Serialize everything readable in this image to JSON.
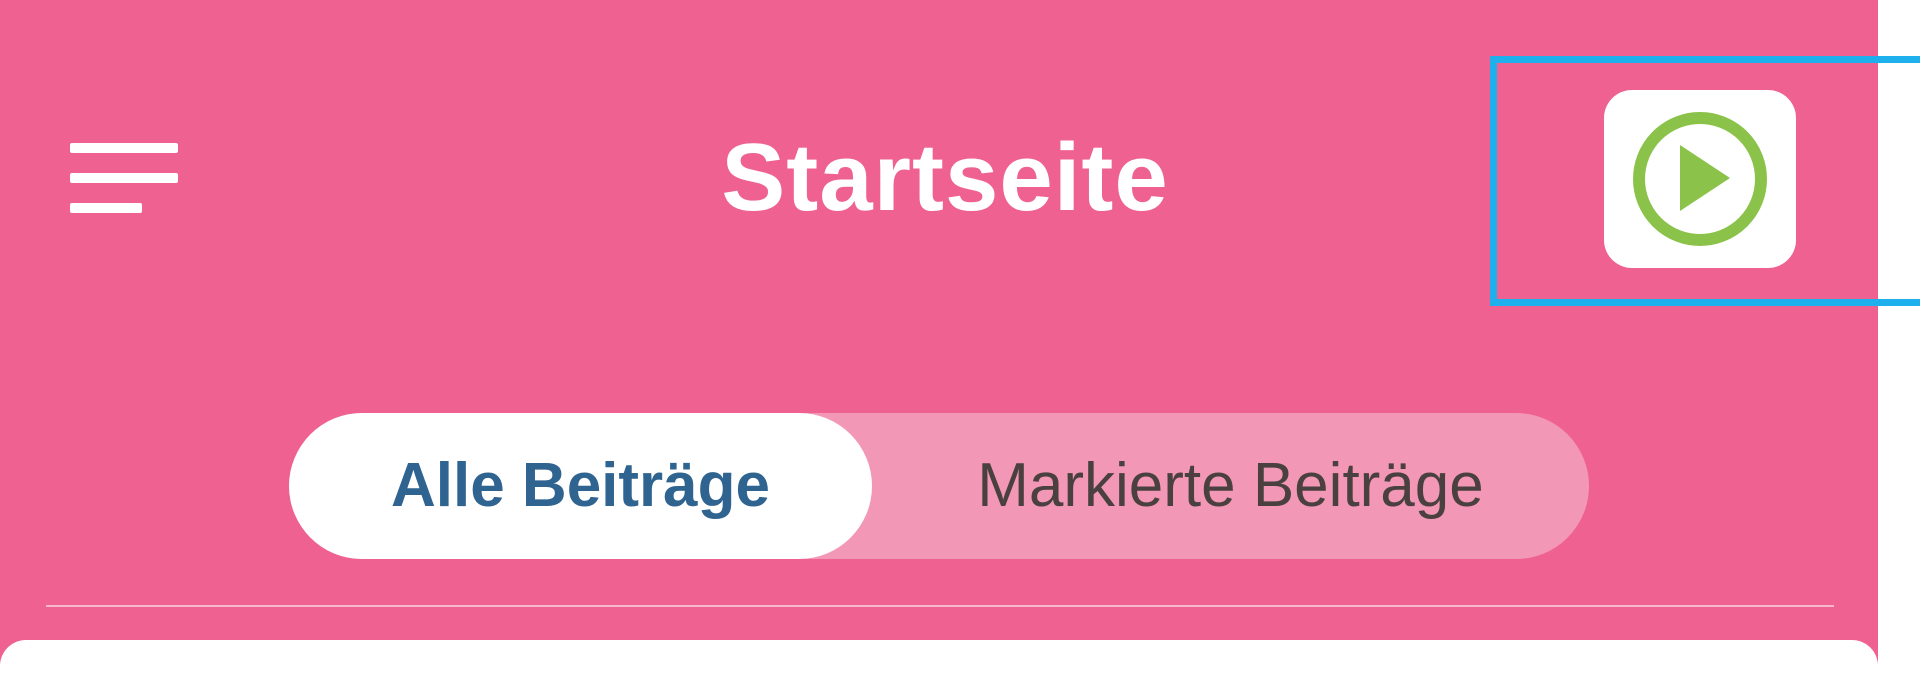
{
  "header": {
    "title": "Startseite",
    "menu_icon": "hamburger-menu-icon",
    "play_icon": "play-circle-icon"
  },
  "tabs": {
    "all_posts": "Alle Beiträge",
    "marked_posts": "Markierte Beiträge",
    "selected": "Alle Beiträge"
  },
  "colors": {
    "header_background": "#ef6190",
    "segmented_background": "#f397b7",
    "active_tab_text": "#2f6390",
    "inactive_tab_text": "#4a4040",
    "play_icon": "#8bc34a",
    "focus_highlight": "#1db0ec"
  }
}
